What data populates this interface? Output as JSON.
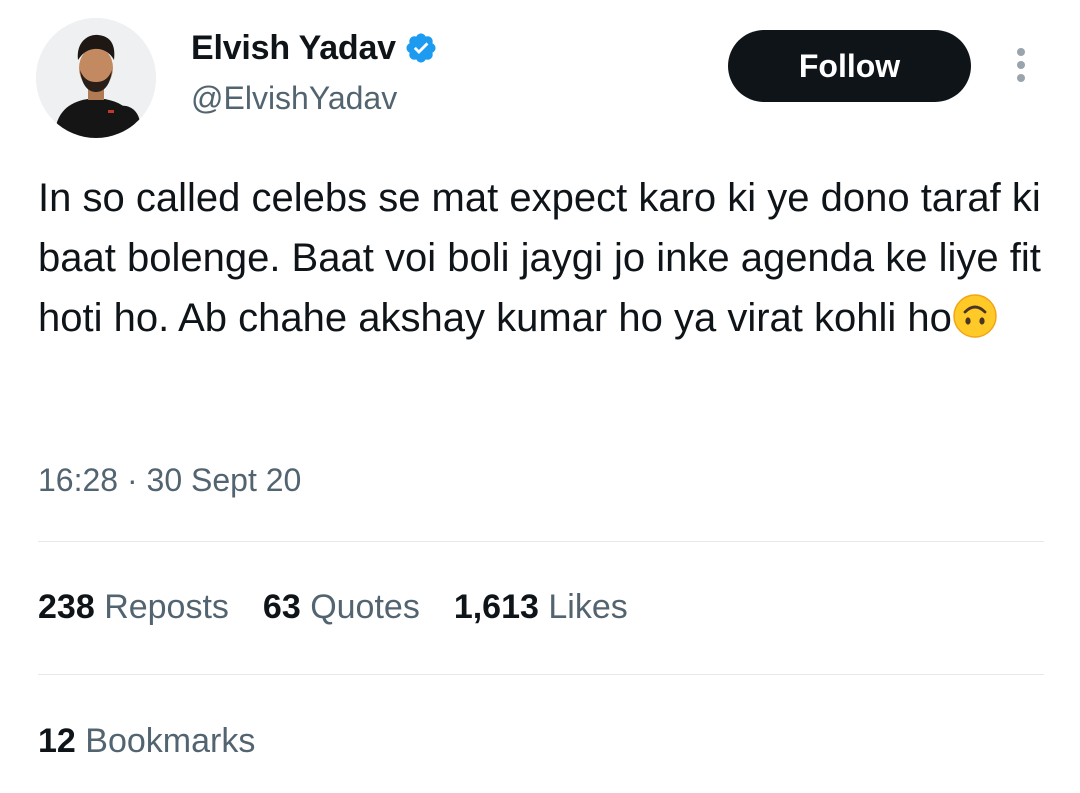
{
  "author": {
    "display_name": "Elvish Yadav",
    "handle": "@ElvishYadav",
    "verified_icon": "verified-badge-icon",
    "verified_color": "#1d9bf0"
  },
  "follow_label": "Follow",
  "tweet": {
    "text": "In so called celebs se mat expect karo ki ye dono taraf ki baat bolenge. Baat voi boli jaygi jo inke agenda ke liye fit hoti ho. Ab chahe akshay kumar ho ya virat kohli ho",
    "emoji": "upside-down-face-icon"
  },
  "meta": {
    "time": "16:28",
    "separator": "·",
    "date": "30 Sept 20"
  },
  "stats": {
    "reposts": {
      "count": "238",
      "label": "Reposts"
    },
    "quotes": {
      "count": "63",
      "label": "Quotes"
    },
    "likes": {
      "count": "1,613",
      "label": "Likes"
    },
    "bookmarks": {
      "count": "12",
      "label": "Bookmarks"
    }
  },
  "colors": {
    "text_primary": "#0f1419",
    "text_secondary": "#536471",
    "follow_bg": "#0f1419",
    "follow_text": "#ffffff",
    "divider": "#e6e9ea"
  }
}
